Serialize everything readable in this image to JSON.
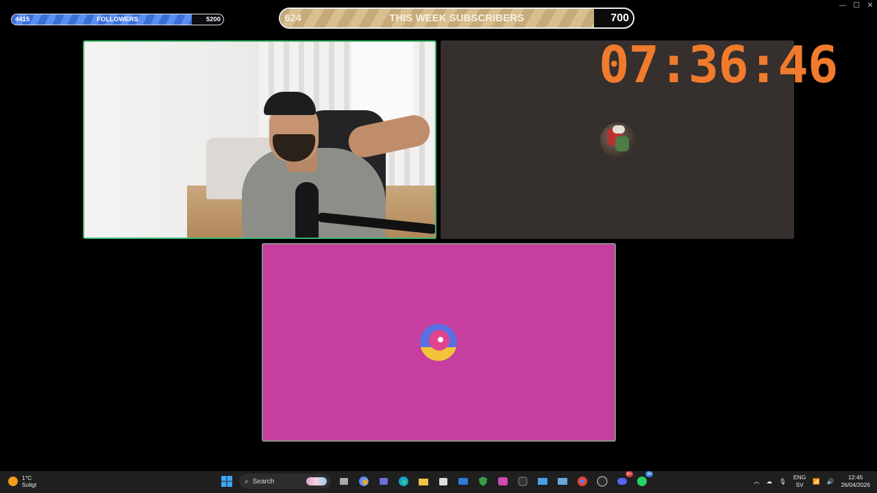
{
  "window_controls": {
    "minimize": "—",
    "maximize": "☐",
    "close": "✕"
  },
  "followers": {
    "current": "4415",
    "label": "FOLLOWERS",
    "goal": "5200",
    "progress_fraction": 0.85
  },
  "subscribers": {
    "current": "624",
    "label": "THIS WEEK SUBSCRIBERS",
    "goal": "700",
    "progress_fraction": 0.89
  },
  "timer": {
    "value": "07:36:46",
    "color": "#f07b2c"
  },
  "tiles": {
    "camera_border_color": "#3bb56a",
    "right_bg": "#352f2e",
    "pink_bg": "#c73f9e"
  },
  "taskbar": {
    "weather": {
      "temp": "1°C",
      "condition": "Soligt"
    },
    "search_placeholder": "Search",
    "apps": [
      "windows-start-icon",
      "task-view-icon",
      "copilot-icon",
      "teams-icon",
      "edge-icon",
      "file-explorer-icon",
      "store-icon",
      "mail-icon",
      "security-icon",
      "m365-icon",
      "dev-icon",
      "photos-icon",
      "screen-icon",
      "chrome-icon",
      "obs-icon",
      "discord-icon",
      "whatsapp-icon"
    ],
    "discord_badge": "9+",
    "whatsapp_badge": "36",
    "tray": {
      "lang": "ENG",
      "layout": "SV",
      "time": "12:45",
      "date": "26/04/2026"
    }
  }
}
